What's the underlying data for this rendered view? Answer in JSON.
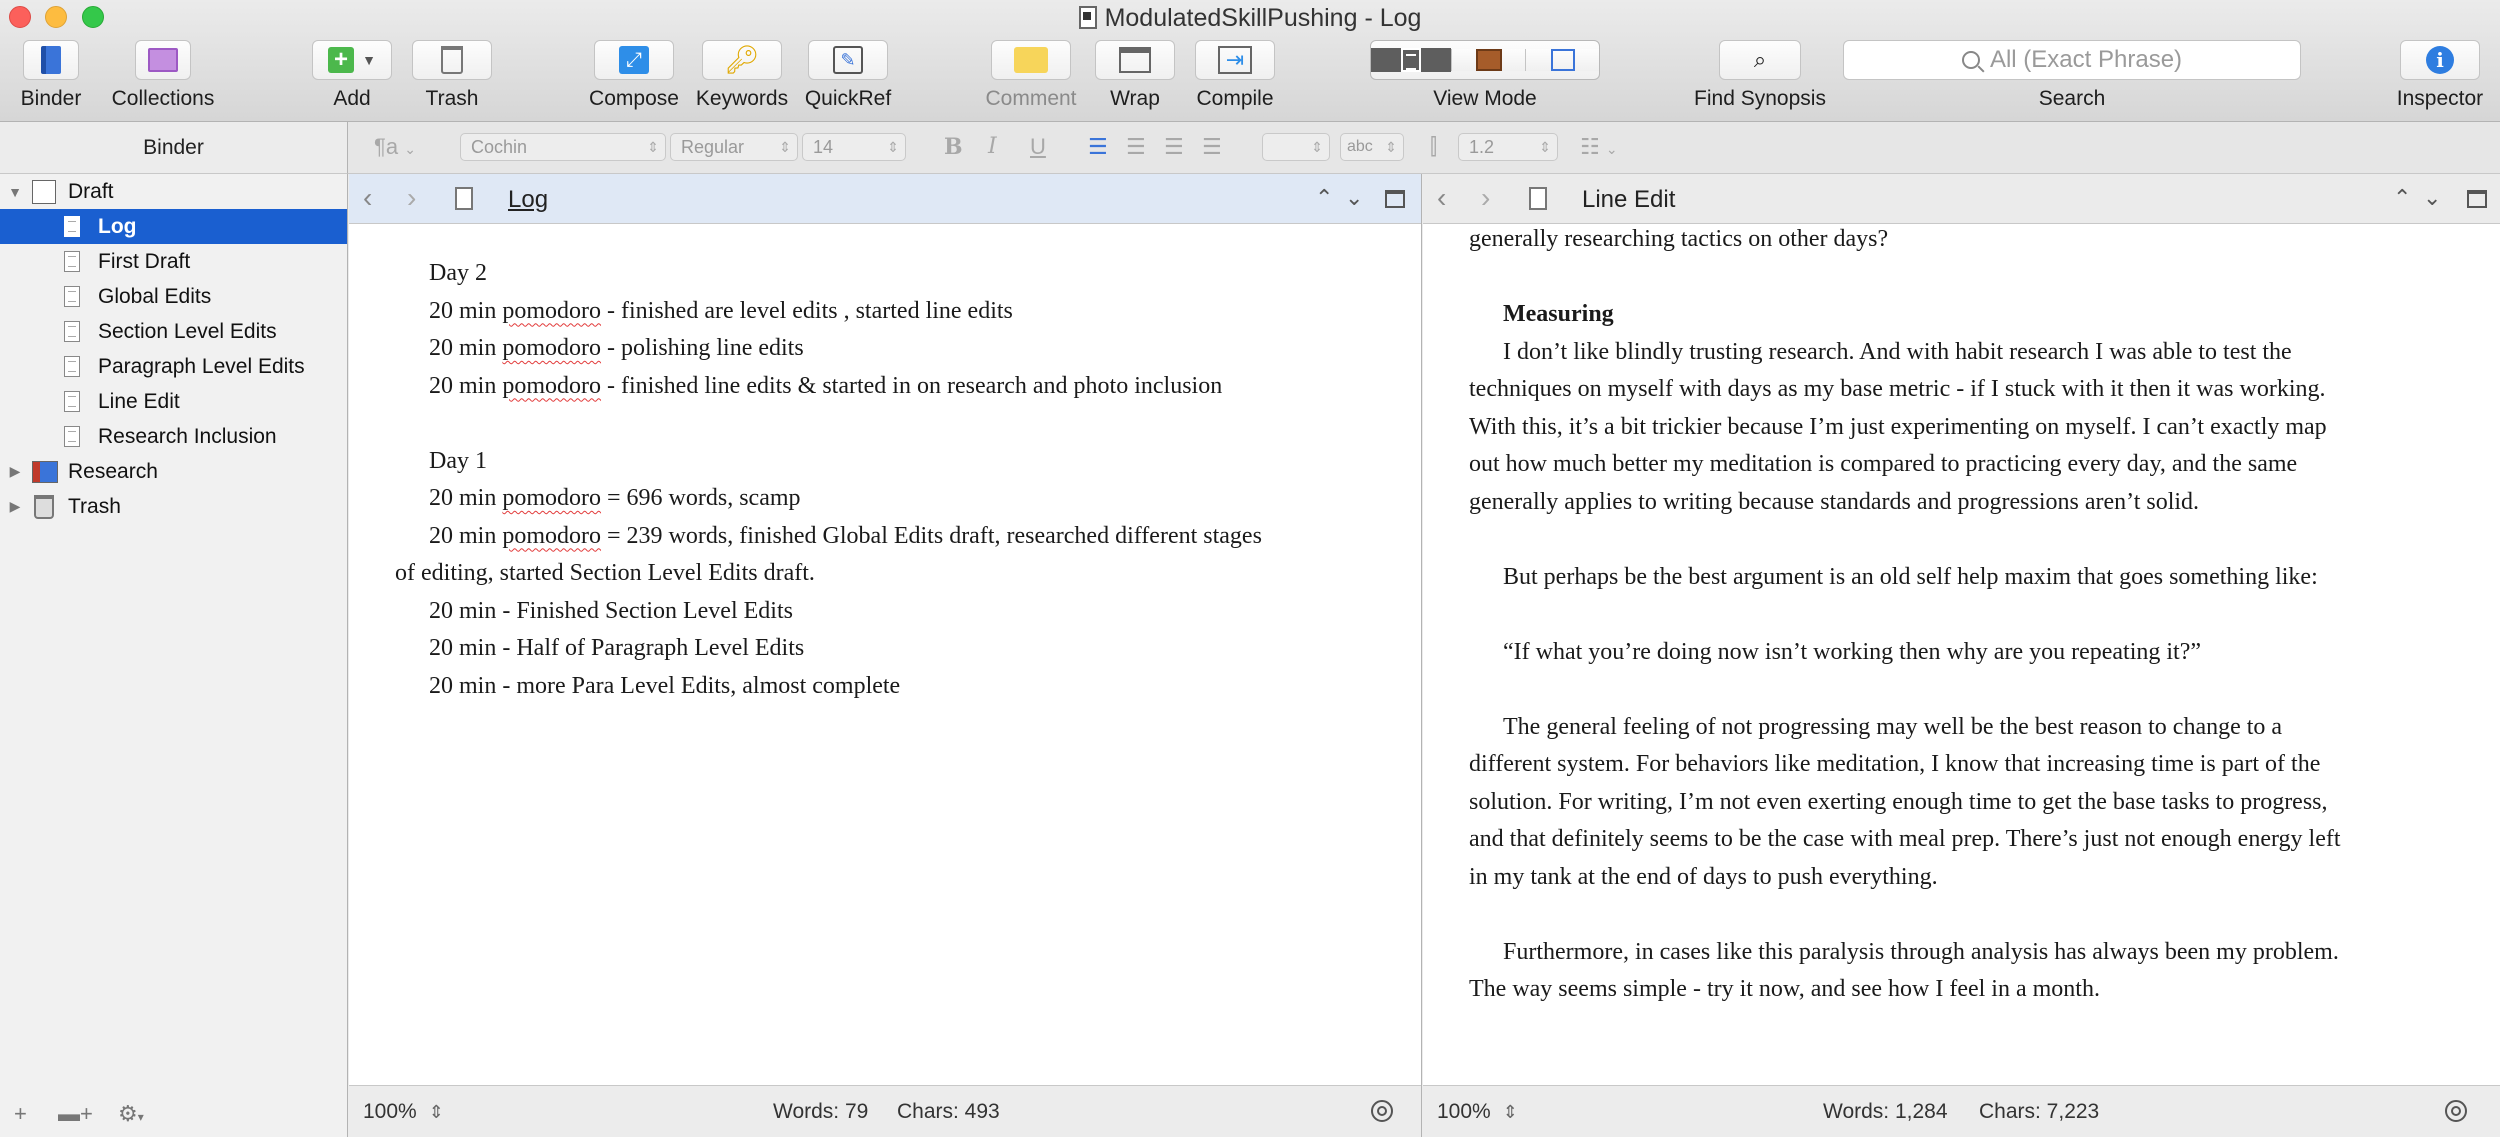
{
  "window": {
    "title": "ModulatedSkillPushing - Log"
  },
  "toolbar": {
    "binder": "Binder",
    "collections": "Collections",
    "add": "Add",
    "trash": "Trash",
    "compose": "Compose",
    "keywords": "Keywords",
    "quickref": "QuickRef",
    "comment": "Comment",
    "wrap": "Wrap",
    "compile": "Compile",
    "view_mode": "View Mode",
    "find_synopsis": "Find Synopsis",
    "search": "Search",
    "search_placeholder": "All (Exact Phrase)",
    "inspector": "Inspector"
  },
  "binder": {
    "header": "Binder",
    "items": [
      {
        "label": "Draft"
      },
      {
        "label": "Log"
      },
      {
        "label": "First Draft"
      },
      {
        "label": "Global Edits"
      },
      {
        "label": "Section Level Edits"
      },
      {
        "label": "Paragraph Level Edits"
      },
      {
        "label": "Line Edit"
      },
      {
        "label": "Research Inclusion"
      },
      {
        "label": "Research"
      },
      {
        "label": "Trash"
      }
    ]
  },
  "format_bar": {
    "para_style": "¶a",
    "font": "Cochin",
    "weight": "Regular",
    "size": "14",
    "text_color_label": "abc",
    "line_spacing": "1.2"
  },
  "left_editor": {
    "title": "Log",
    "zoom": "100%",
    "words_label": "Words: 79",
    "chars_label": "Chars: 493",
    "lines": {
      "day2": "Day 2",
      "l1_pre": "20 min ",
      "l1_word": "pomodoro",
      "l1_post": " - finished are level edits , started line edits",
      "l2_pre": "20 min ",
      "l2_word": "pomodoro",
      "l2_post": " - polishing line edits",
      "l3_pre": "20 min ",
      "l3_word": "pomodoro",
      "l3_post": " - finished line edits & started in on research and photo inclusion",
      "day1": "Day 1",
      "l4_pre": "20 min ",
      "l4_word": "pomodoro",
      "l4_post": " = 696 words, scamp",
      "l5_pre": "20 min ",
      "l5_word": "pomodoro",
      "l5_post": " = 239 words, finished Global Edits draft, researched different stages",
      "l5_cont": "of editing, started Section Level Edits draft.",
      "l6": "20 min - Finished Section Level Edits",
      "l7": "20 min - Half of Paragraph Level Edits",
      "l8": "20 min - more Para Level Edits, almost complete"
    }
  },
  "right_editor": {
    "title": "Line Edit",
    "zoom": "100%",
    "words_label": "Words: 1,284",
    "chars_label": "Chars: 7,223",
    "lines": [
      "generally researching tactics on other days?",
      "Measuring",
      "I don’t like blindly trusting research. And with habit research I was able to test the",
      "techniques on myself with days as my base metric - if I stuck with it then it was working.",
      "With this, it’s a bit trickier because I’m just experimenting on myself. I can’t exactly map",
      "out how much better my meditation is compared to practicing every day, and the same",
      "generally applies to writing because standards and progressions aren’t solid.",
      "But perhaps be the best argument is an old self help maxim that goes something like:",
      "“If what you’re doing now isn’t working then why are you repeating it?”",
      "The general feeling of not progressing may well be the best reason to change to a",
      "different system. For behaviors like meditation, I know that increasing time is part of the",
      "solution. For writing, I’m not even exerting enough time to get the base tasks to progress,",
      "and that definitely seems to be the case with meal prep. There’s just not enough energy left",
      "in my tank at the end of days to push everything.",
      "Furthermore, in cases like this paralysis through analysis has always been my problem.",
      "The way seems simple - try it now, and see how I feel in a month."
    ]
  },
  "colors": {
    "selection": "#1a5fd0",
    "spellcheck": "#e23b3b",
    "left_header_bg": "#dfe8f5"
  }
}
